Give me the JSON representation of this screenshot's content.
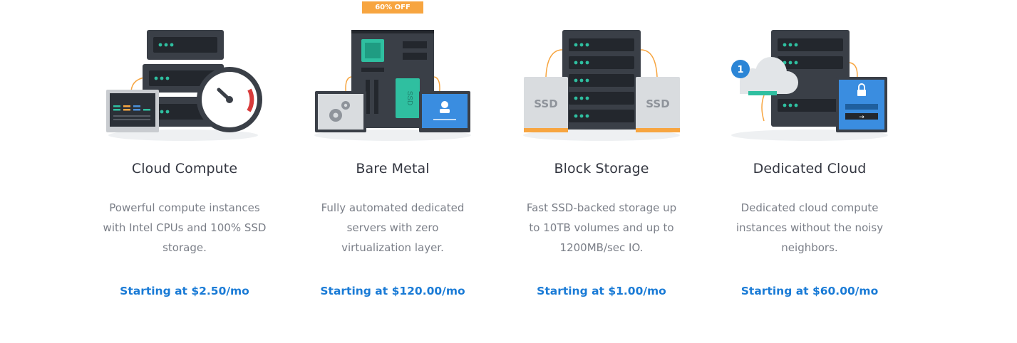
{
  "badge": {
    "label": "60% OFF",
    "color": "#f7a540"
  },
  "accent_color": "#1a7bd6",
  "products": [
    {
      "title": "Cloud Compute",
      "description": "Powerful compute instances with Intel CPUs and 100% SSD storage.",
      "price": "Starting at $2.50/mo",
      "icon": "cloud-compute-illustration"
    },
    {
      "title": "Bare Metal",
      "description": "Fully automated dedicated servers with zero virtualization layer.",
      "price": "Starting at $120.00/mo",
      "icon": "bare-metal-illustration",
      "chip_label": "SSD"
    },
    {
      "title": "Block Storage",
      "description": "Fast SSD-backed storage up to 10TB volumes and up to 1200MB/sec IO.",
      "price": "Starting at $1.00/mo",
      "icon": "block-storage-illustration",
      "disk_labels": [
        "SSD",
        "SSD"
      ]
    },
    {
      "title": "Dedicated Cloud",
      "description": "Dedicated cloud compute instances without the noisy neighbors.",
      "price": "Starting at $60.00/mo",
      "icon": "dedicated-cloud-illustration",
      "cloud_number": "1",
      "login_arrow": "→"
    }
  ]
}
